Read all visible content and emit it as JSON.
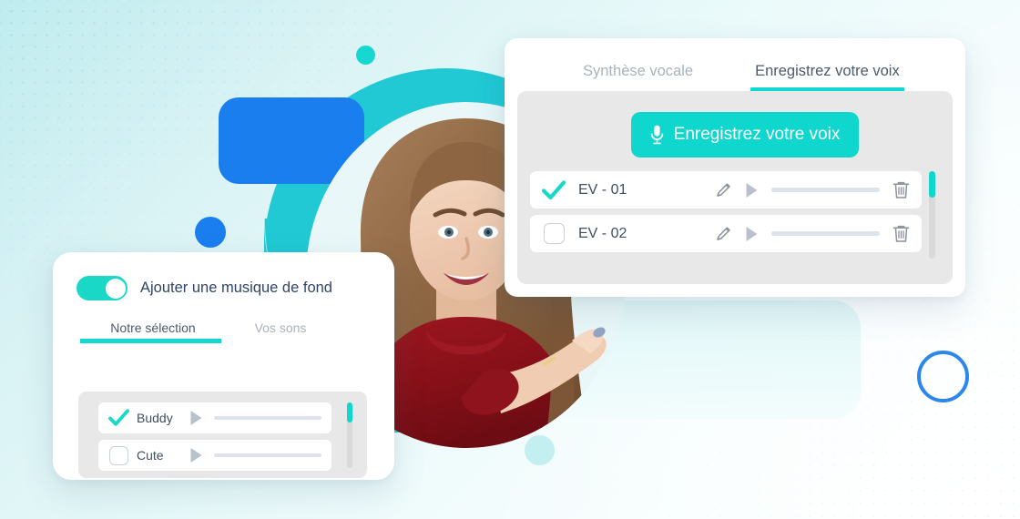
{
  "voice_card": {
    "tabs": [
      {
        "label": "Synthèse vocale",
        "active": false
      },
      {
        "label": "Enregistrez votre voix",
        "active": true
      }
    ],
    "record_button": {
      "label": "Enregistrez votre voix",
      "icon": "microphone-icon",
      "color": "#0fd7ce"
    },
    "recordings": [
      {
        "name": "EV - 01",
        "checked": true,
        "icons": [
          "pencil-icon",
          "play-icon",
          "trash-icon"
        ]
      },
      {
        "name": "EV - 02",
        "checked": false,
        "icons": [
          "pencil-icon",
          "play-icon",
          "trash-icon"
        ]
      }
    ]
  },
  "music_card": {
    "toggle": {
      "label": "Ajouter une musique de fond",
      "on": true
    },
    "tabs": [
      {
        "label": "Notre sélection",
        "active": true
      },
      {
        "label": "Vos sons",
        "active": false
      }
    ],
    "sounds": [
      {
        "name": "Buddy",
        "checked": true,
        "icons": [
          "play-icon"
        ]
      },
      {
        "name": "Cute",
        "checked": false,
        "icons": [
          "play-icon"
        ]
      }
    ]
  },
  "theme": {
    "accent_teal": "#0fd7ce",
    "accent_blue": "#1a7eef",
    "blob_teal": "#20c9d4",
    "text_dark": "#3f4f63",
    "text_muted": "#a9b2bb",
    "panel_gray": "#e8e8e8"
  }
}
